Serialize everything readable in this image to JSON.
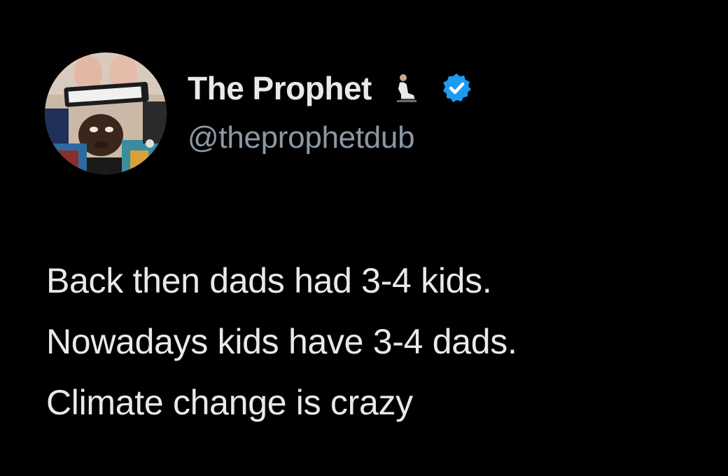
{
  "tweet": {
    "author": {
      "display_name": "The Prophet",
      "name_emoji": "person-kneeling-icon",
      "handle": "@theprophetdub",
      "verified": true,
      "verified_badge_color": "#1d9bf0",
      "avatar": "profile-photo"
    },
    "text_lines": [
      "Back then dads had 3-4 kids.",
      "Nowadays kids have 3-4 dads.",
      "Climate change is crazy"
    ]
  },
  "theme": {
    "background": "#000000",
    "primary_text": "#e7e9ea",
    "secondary_text": "#8b98a5",
    "accent": "#1d9bf0"
  }
}
